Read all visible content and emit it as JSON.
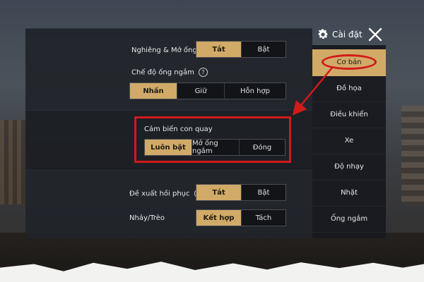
{
  "header": {
    "title": "Cài đặt",
    "gear_icon": "gear-icon",
    "close_icon": "close-icon"
  },
  "sidebar": {
    "items": [
      {
        "label": "Cơ bản",
        "active": true
      },
      {
        "label": "Đồ họa",
        "active": false
      },
      {
        "label": "Điều khiển",
        "active": false
      },
      {
        "label": "Xe",
        "active": false
      },
      {
        "label": "Độ nhạy",
        "active": false
      },
      {
        "label": "Nhặt",
        "active": false
      },
      {
        "label": "Ống ngắm",
        "active": false
      }
    ]
  },
  "settings": {
    "lean_scope": {
      "label": "Nghiêng & Mở ống ngắm",
      "options": [
        "Tắt",
        "Bật"
      ],
      "selected": "Tắt"
    },
    "scope_mode": {
      "label": "Chế độ ống ngắm",
      "help_icon": "?",
      "options": [
        "Nhấn",
        "Giữ",
        "Hỗn hợp"
      ],
      "selected": "Nhấn"
    },
    "gyroscope": {
      "label": "Cảm biến con quay",
      "options": [
        "Luôn bật",
        "Mở ống ngắm",
        "Đóng"
      ],
      "selected": "Luôn bật"
    },
    "recovery_suggest": {
      "label": "Đề xuất hồi phục",
      "help_icon": "?",
      "options": [
        "Tắt",
        "Bật"
      ],
      "selected": "Tắt"
    },
    "jump_climb": {
      "label": "Nhảy/Trèo",
      "options": [
        "Kết hợp",
        "Tách"
      ],
      "selected": "Kết hợp"
    }
  },
  "colors": {
    "accent": "#d1aa68",
    "annotation": "#d11a1a",
    "panel": "#202329"
  }
}
